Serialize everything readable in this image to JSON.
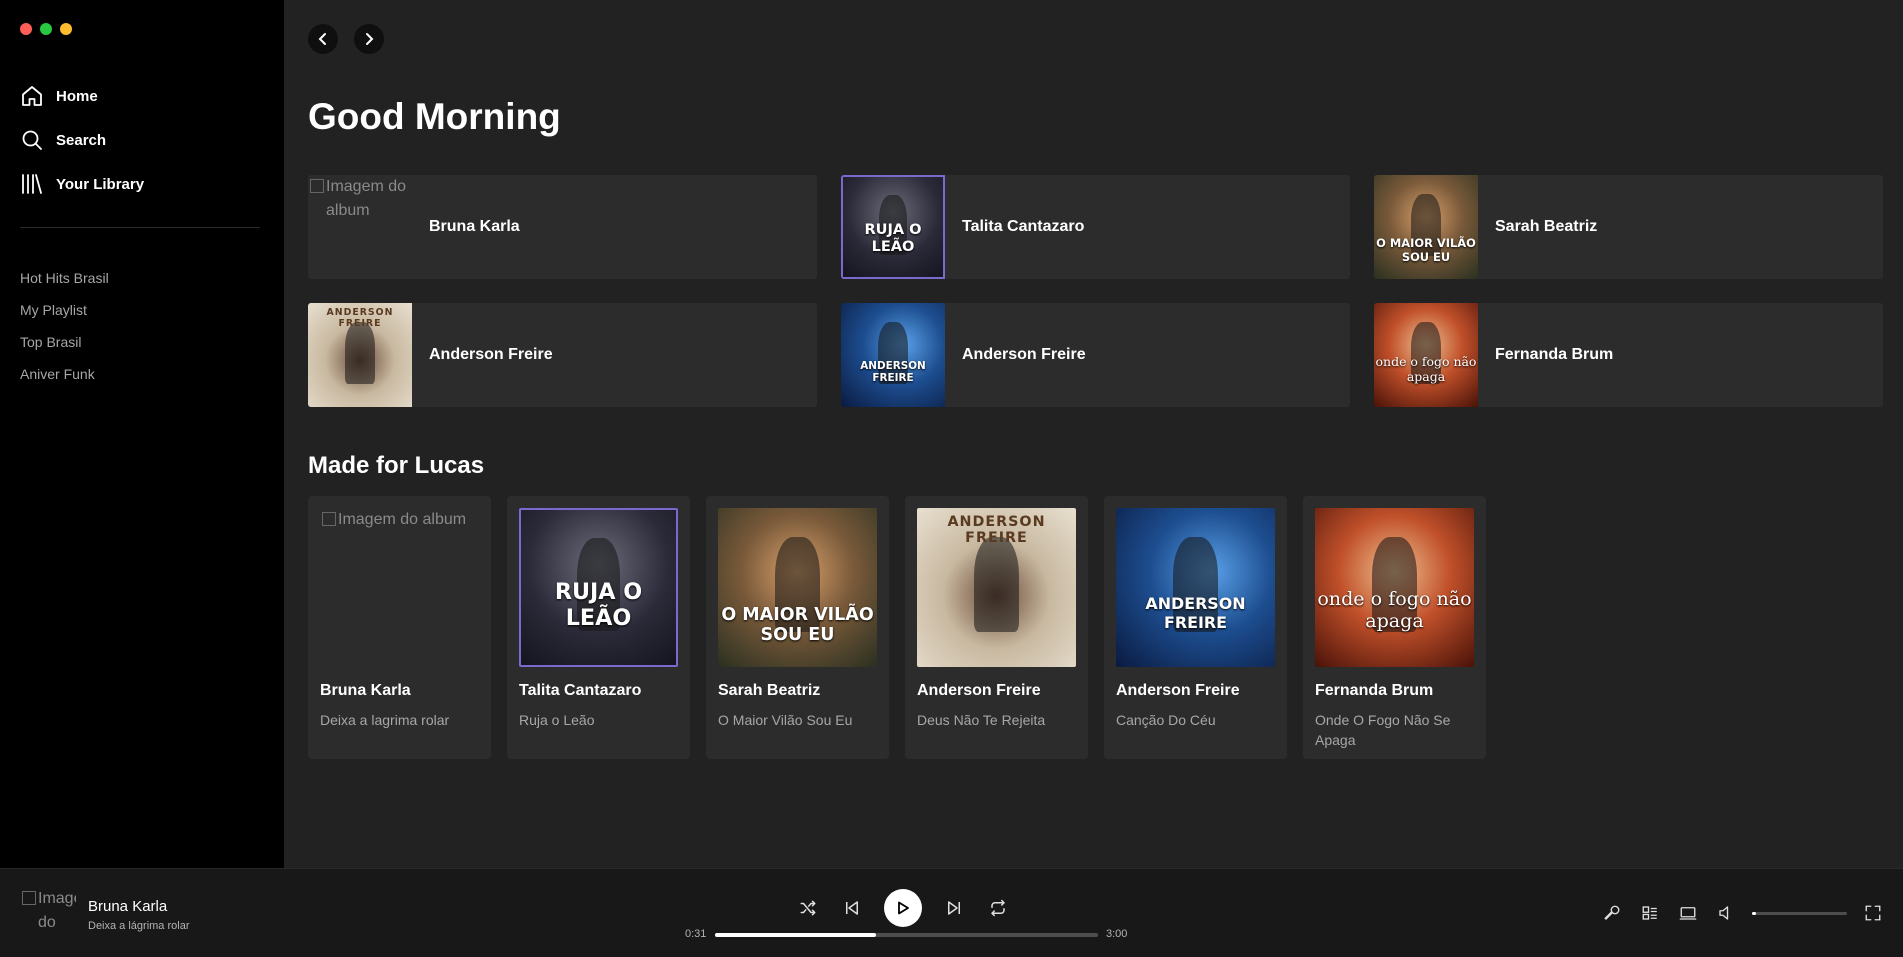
{
  "window": {
    "traffic_lights": [
      "#ff5f57",
      "#28c840",
      "#febc2e"
    ]
  },
  "sidebar": {
    "nav": [
      {
        "label": "Home",
        "icon": "home-icon"
      },
      {
        "label": "Search",
        "icon": "search-icon"
      },
      {
        "label": "Your Library",
        "icon": "library-icon"
      }
    ],
    "playlists": [
      "Hot Hits Brasil",
      "My Playlist",
      "Top Brasil",
      "Aniver Funk"
    ]
  },
  "main": {
    "greeting": "Good Morning",
    "quick_picks": [
      {
        "title": "Bruna Karla",
        "cover_alt": "Imagem do album",
        "art": "broken"
      },
      {
        "title": "Talita Cantazaro",
        "art": "talita",
        "art_text": "RUJA O LEÃO"
      },
      {
        "title": "Sarah Beatriz",
        "art": "sarah",
        "art_text": "O MAIOR VILÃO SOU EU"
      },
      {
        "title": "Anderson Freire",
        "art": "anderson1",
        "art_text": "ANDERSON FREIRE"
      },
      {
        "title": "Anderson Freire",
        "art": "anderson2",
        "art_text": "ANDERSON FREIRE"
      },
      {
        "title": "Fernanda Brum",
        "art": "fernanda",
        "art_text": "onde o fogo não apaga"
      }
    ],
    "section_title": "Made for Lucas",
    "made_for": [
      {
        "title": "Bruna Karla",
        "subtitle": "Deixa a lagrima rolar",
        "cover_alt": "Imagem do album",
        "art": "broken"
      },
      {
        "title": "Talita Cantazaro",
        "subtitle": "Ruja o Leão",
        "art": "talita",
        "art_text": "RUJA O LEÃO"
      },
      {
        "title": "Sarah Beatriz",
        "subtitle": "O Maior Vilão Sou Eu",
        "art": "sarah",
        "art_text": "O MAIOR VILÃO SOU EU"
      },
      {
        "title": "Anderson Freire",
        "subtitle": "Deus Não Te Rejeita",
        "art": "anderson1",
        "art_text": "ANDERSON FREIRE"
      },
      {
        "title": "Anderson Freire",
        "subtitle": "Canção Do Céu",
        "art": "anderson2",
        "art_text": "ANDERSON FREIRE"
      },
      {
        "title": "Fernanda Brum",
        "subtitle": "Onde O Fogo Não Se Apaga",
        "art": "fernanda",
        "art_text": "onde o fogo não apaga"
      }
    ]
  },
  "player": {
    "cover_alt": "Imagem do",
    "track_title": "Bruna Karla",
    "track_artist": "Deixa a lágrima rolar",
    "elapsed": "0:31",
    "duration": "3:00",
    "progress_fraction": 0.42,
    "volume_fraction": 0.04
  }
}
